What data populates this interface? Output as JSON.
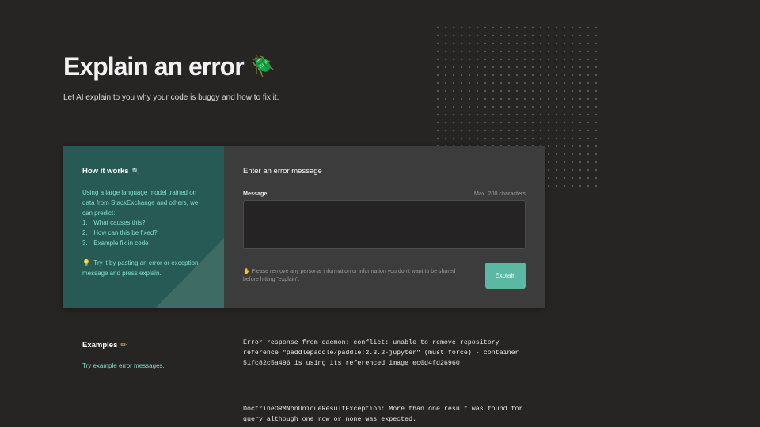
{
  "hero": {
    "title": "Explain an error",
    "title_icon": "🪲",
    "subtitle": "Let AI explain to you why your code is buggy and how to fix it."
  },
  "how_it_works": {
    "title": "How it works",
    "title_icon": "🔍",
    "description": "Using a large language model trained on data from StackExchange and others, we can predict:",
    "steps": [
      {
        "num": "1.",
        "text": "What causes this?"
      },
      {
        "num": "2.",
        "text": "How can this be fixed?"
      },
      {
        "num": "3.",
        "text": "Example fix in code"
      }
    ],
    "tip_icon": "💡",
    "tip": "Try it by pasting an error or exception message and press explain."
  },
  "form": {
    "title": "Enter an error message",
    "message_label": "Message",
    "max_label": "Max. 200 characters",
    "message_value": "",
    "privacy_icon": "✋",
    "privacy_note": "Please remove any personal information or information you don't want to be shared before hitting \"explain\".",
    "submit_label": "Explain"
  },
  "examples": {
    "title": "Examples",
    "title_icon": "✏",
    "link": "Try example error messages.",
    "items": [
      "Error response from daemon: conflict: unable to remove repository reference \"paddlepaddle/paddle:2.3.2-jupyter\" (must force) - container 51fc82c5a496 is using its referenced image ec0d4fd26960",
      "DoctrineORMNonUniqueResultException: More than one result was found for query although one row or none was expected."
    ]
  },
  "colors": {
    "background": "#272424",
    "panel_left": "#275a54",
    "panel_right": "#3d3c3c",
    "accent_text": "#7fe0cc",
    "button": "#5bb8a3"
  }
}
